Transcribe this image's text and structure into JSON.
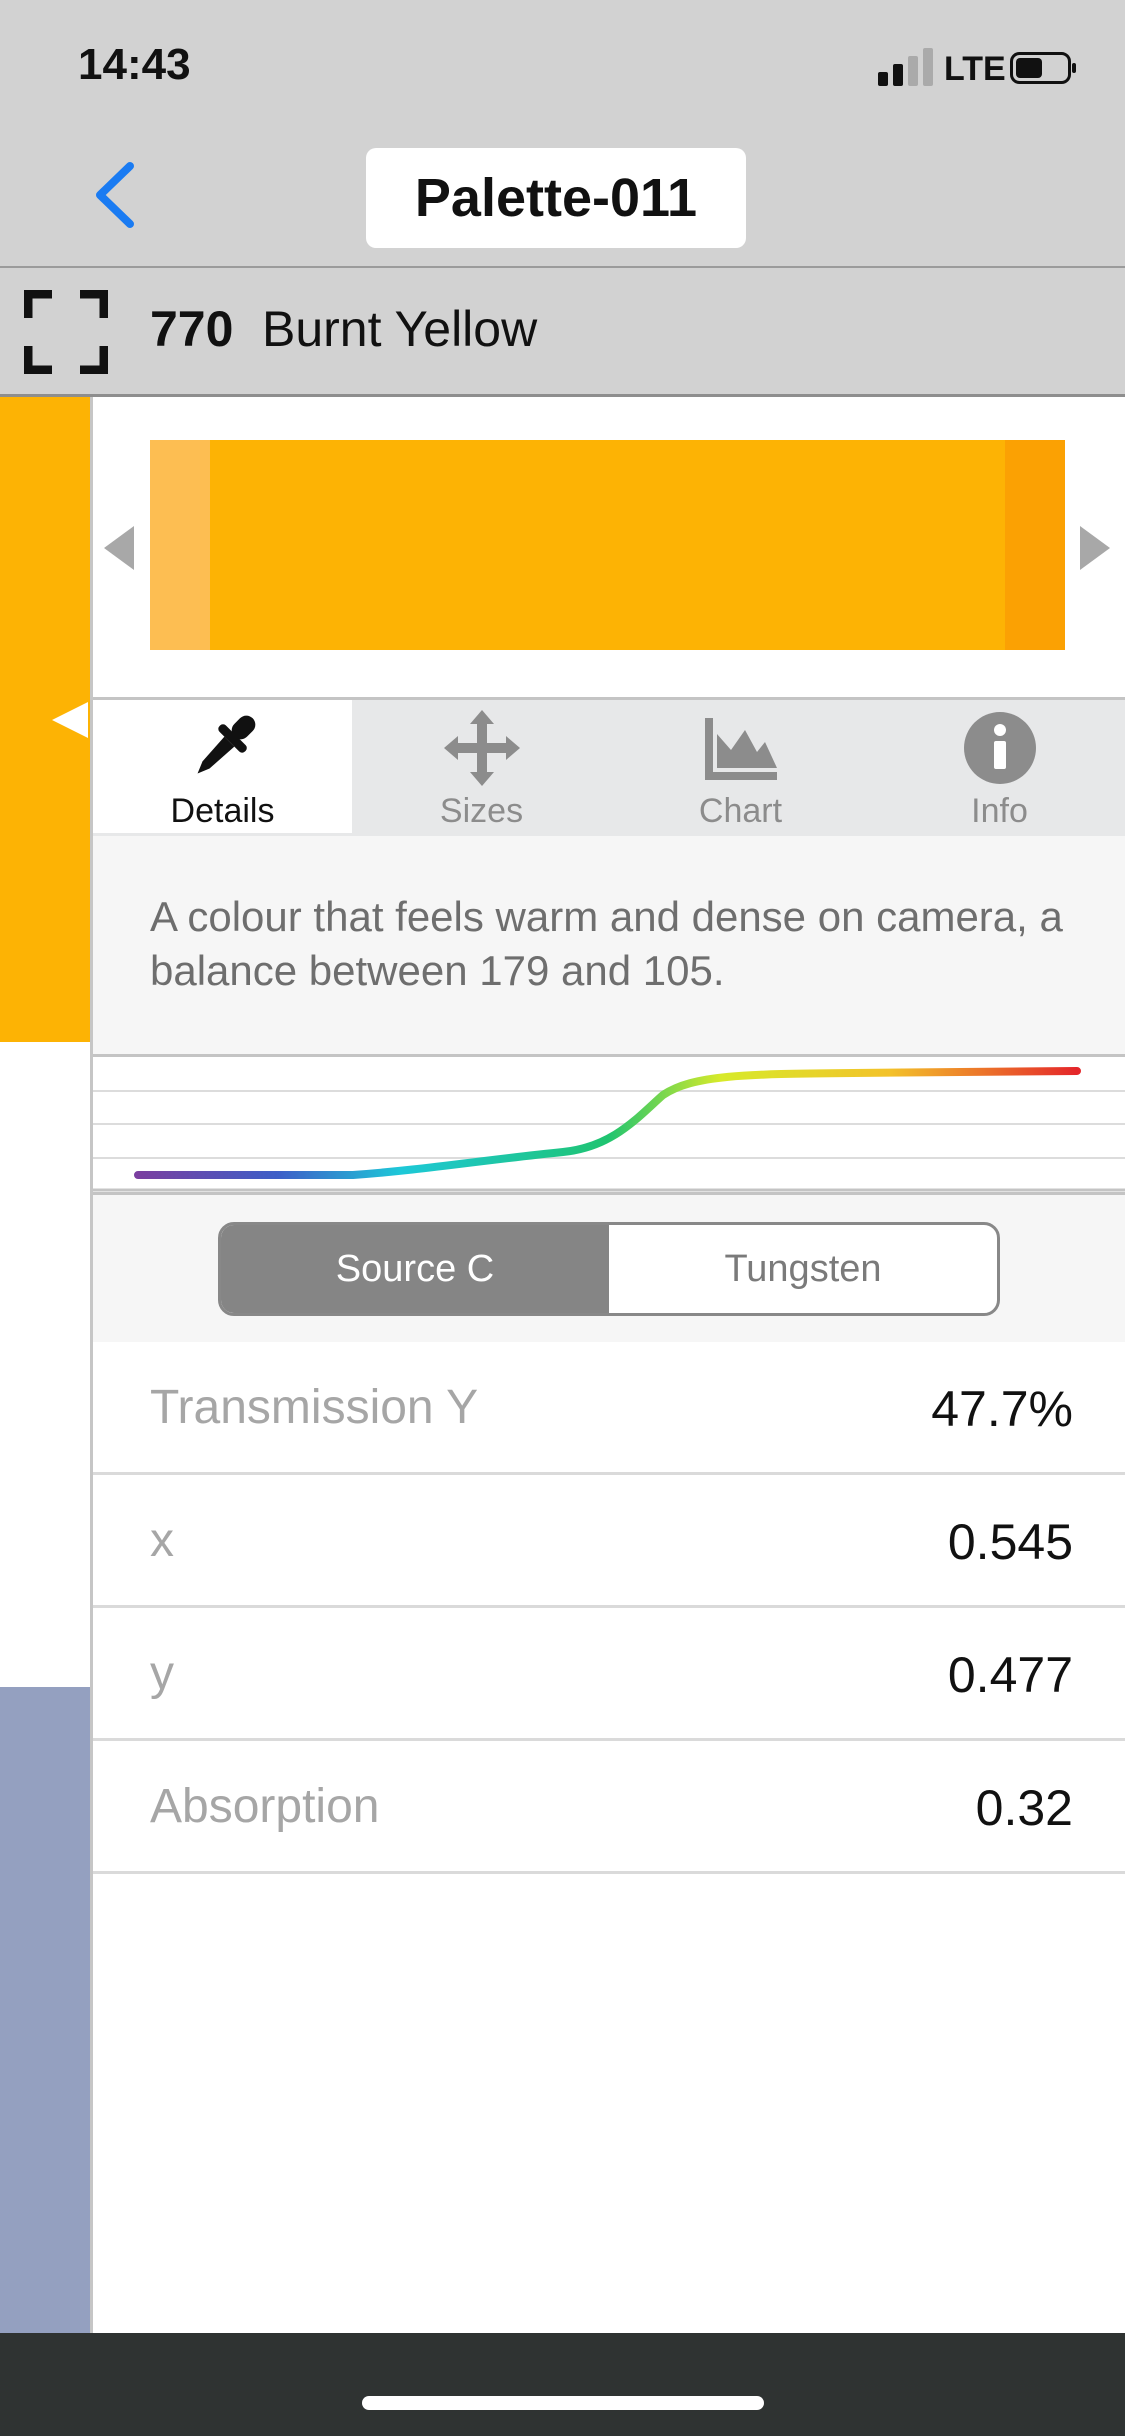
{
  "status_bar": {
    "time": "14:43",
    "network": "LTE"
  },
  "nav": {
    "title": "Palette-011"
  },
  "colour": {
    "number": "770",
    "name": "Burnt Yellow",
    "swatch_color": "#fdb304",
    "next_strip_color": "#94a0c0"
  },
  "tabs": [
    {
      "label": "Details",
      "icon": "eyedropper-icon",
      "active": true
    },
    {
      "label": "Sizes",
      "icon": "move-arrows-icon",
      "active": false
    },
    {
      "label": "Chart",
      "icon": "area-chart-icon",
      "active": false
    },
    {
      "label": "Info",
      "icon": "info-icon",
      "active": false
    }
  ],
  "description": "A colour that feels warm and dense on camera, a balance between 179 and 105.",
  "illuminant": {
    "options": [
      "Source C",
      "Tungsten"
    ],
    "selected": "Source C"
  },
  "properties": [
    {
      "label": "Transmission Y",
      "value": "47.7%"
    },
    {
      "label": "x",
      "value": "0.545"
    },
    {
      "label": "y",
      "value": "0.477"
    },
    {
      "label": "Absorption",
      "value": "0.32"
    }
  ],
  "colors": {
    "accent": "#1a7bf2",
    "segment_selected": "#858585"
  }
}
